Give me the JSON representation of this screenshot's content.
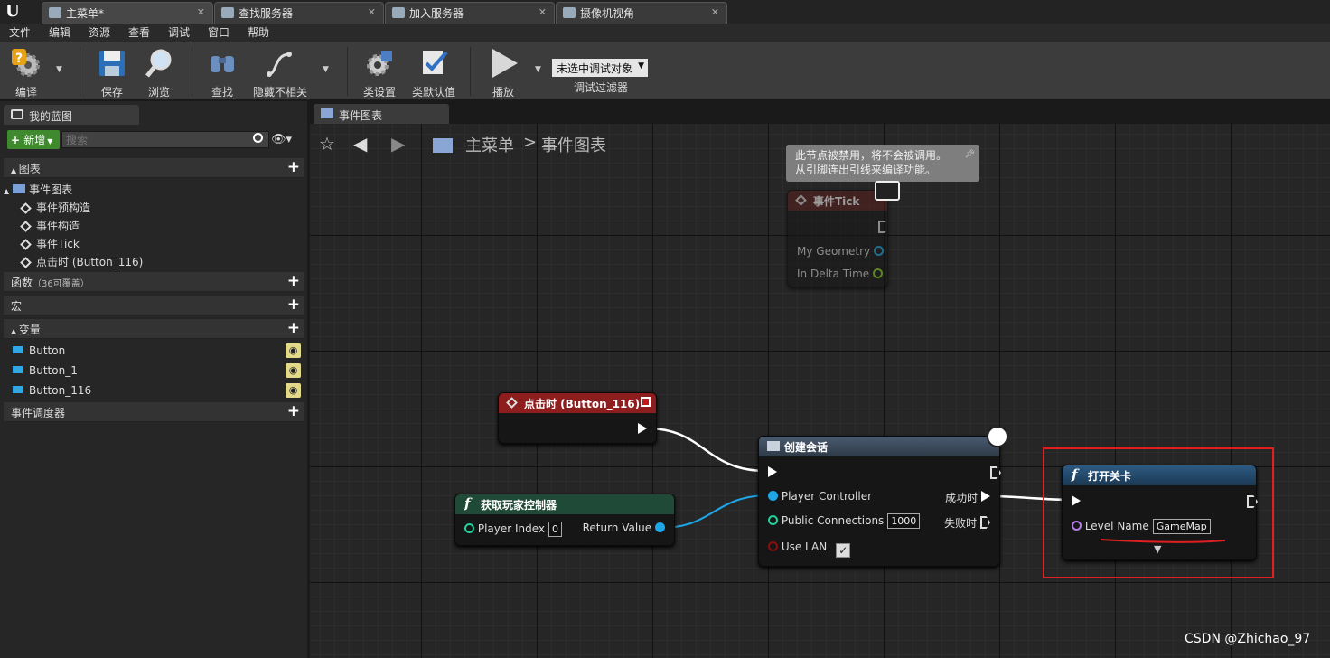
{
  "tabs": [
    {
      "label": "主菜单*"
    },
    {
      "label": "查找服务器"
    },
    {
      "label": "加入服务器"
    },
    {
      "label": "摄像机视角"
    }
  ],
  "menu": [
    "文件",
    "编辑",
    "资源",
    "查看",
    "调试",
    "窗口",
    "帮助"
  ],
  "toolbar": {
    "compile": "编译",
    "save": "保存",
    "browse": "浏览",
    "find": "查找",
    "hide_unrelated": "隐藏不相关",
    "class_settings": "类设置",
    "class_defaults": "类默认值",
    "play": "播放",
    "debug_select": "未选中调试对象",
    "debug_filter": "调试过滤器"
  },
  "left": {
    "tab": "我的蓝图",
    "add_new": "新增",
    "search_placeholder": "搜索",
    "graphs_header": "图表",
    "event_graph": "事件图表",
    "events": [
      "事件预构造",
      "事件构造",
      "事件Tick",
      "点击时 (Button_116)"
    ],
    "functions_header": "函数",
    "functions_note": "（36可覆盖）",
    "macros_header": "宏",
    "variables_header": "变量",
    "variables": [
      "Button",
      "Button_1",
      "Button_116"
    ],
    "dispatchers_header": "事件调度器"
  },
  "graph": {
    "tab": "事件图表",
    "breadcrumb_root": "主菜单",
    "breadcrumb_sep": ">",
    "breadcrumb_leaf": "事件图表",
    "disabled_tooltip": [
      "此节点被禁用，将不会被调用。",
      "从引脚连出引线来编译功能。"
    ],
    "tick_node": {
      "title": "事件Tick",
      "pins": [
        "My Geometry",
        "In Delta Time"
      ]
    },
    "click_node": {
      "title": "点击时 (Button_116)"
    },
    "get_pc_node": {
      "title": "获取玩家控制器",
      "player_index_label": "Player Index",
      "player_index": "0",
      "return_label": "Return Value"
    },
    "session_node": {
      "title": "创建会话",
      "pc_label": "Player Controller",
      "conn_label": "Public Connections",
      "conn_value": "1000",
      "lan_label": "Use LAN",
      "success": "成功时",
      "fail": "失败时"
    },
    "open_level_node": {
      "title": "打开关卡",
      "level_label": "Level Name",
      "level_value": "GameMap"
    },
    "watermark": "CSDN @Zhichao_97"
  },
  "colors": {
    "event_head": "#8e1d1d",
    "func_head": "#1f4a37",
    "latent_head": "#3b4a5e",
    "open_head": "#23435f",
    "highlight": "#e02020",
    "object_pin": "#1ea7e8",
    "int_pin": "#1fd19a",
    "name_pin": "#b57ee8",
    "bool_pin": "#8c0d0d"
  }
}
